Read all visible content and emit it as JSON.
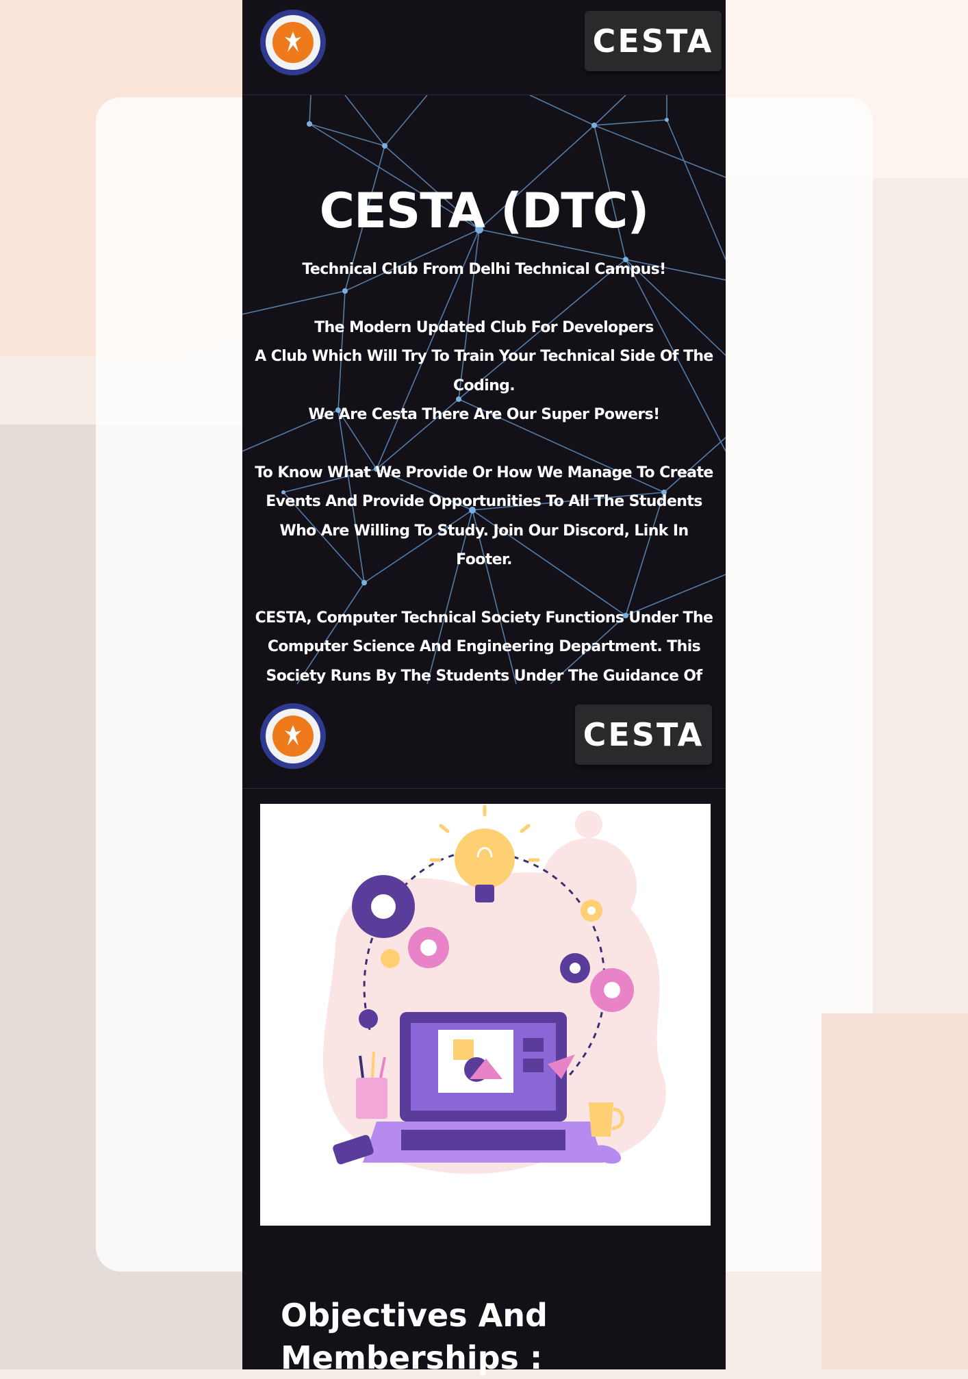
{
  "header": {
    "left_logo": "delhi-technical-campus-logo",
    "right_logo_text": "CESTA"
  },
  "hero": {
    "title": "CESTA (DTC)",
    "subtitle": "Technical Club From Delhi Technical Campus!",
    "lines_a": [
      "The Modern Updated Club For Developers",
      "A Club Which Will Try To Train Your Technical Side Of The Coding.",
      "We Are Cesta There Are Our Super Powers!"
    ],
    "paragraph_b": "To Know What We Provide Or How We Manage To Create Events And Provide Opportunities To All The Students Who Are Willing To Study. Join Our Discord, Link In Footer.",
    "paragraph_c": "CESTA, Computer Technical Society Functions Under The Computer Science And Engineering Department. This Society Runs By The Students Under The Guidance Of Faculty And Technical Society Heads"
  },
  "header2": {
    "right_logo_text": "CESTA"
  },
  "illustration": "laptop-lightbulb-gears-illustration",
  "section": {
    "title": "Objectives And Memberships :"
  },
  "colors": {
    "page_bg": "#141018",
    "network_line": "#5f8fc0",
    "accent_orange": "#ee7a1c",
    "accent_purple": "#6a4fb5"
  }
}
